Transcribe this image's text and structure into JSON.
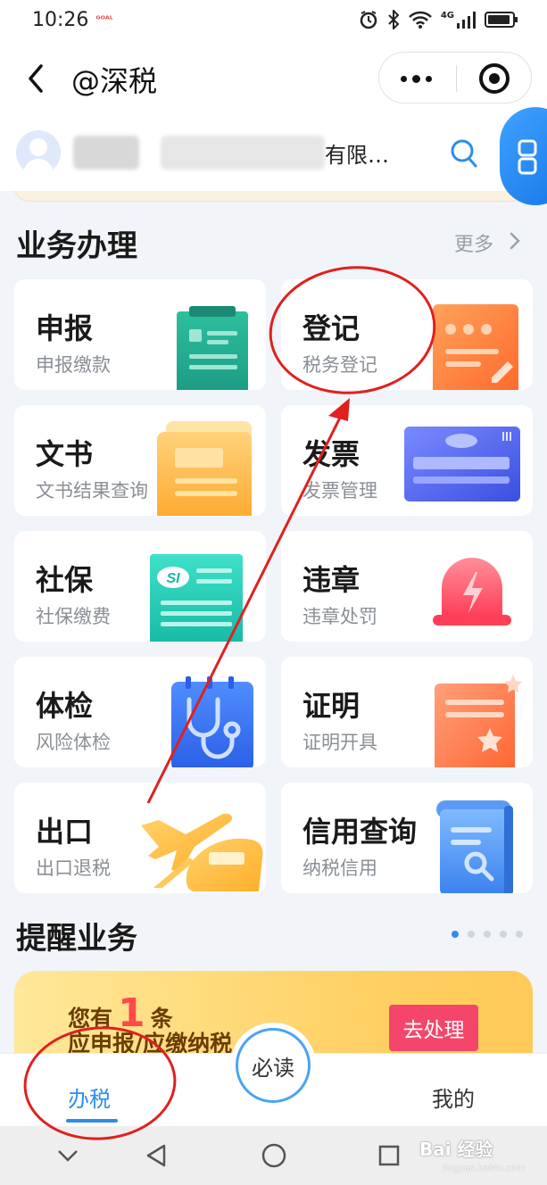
{
  "status_bar": {
    "time": "10:26",
    "badge_text": "ᴳᴼᴬᴸ",
    "network": "4G",
    "colors": {
      "text": "#222222"
    }
  },
  "nav": {
    "title": "@深税",
    "back_icon": "chevron-left-icon",
    "more_icon": "more-dots-icon",
    "close_icon": "target-icon"
  },
  "account": {
    "company_name": "有限…",
    "search_icon": "search-icon",
    "float_icon": "grid-icon"
  },
  "business": {
    "title": "业务办理",
    "more_label": "更多",
    "items": [
      {
        "title": "申报",
        "subtitle": "申报缴款"
      },
      {
        "title": "登记",
        "subtitle": "税务登记"
      },
      {
        "title": "文书",
        "subtitle": "文书结果查询"
      },
      {
        "title": "发票",
        "subtitle": "发票管理"
      },
      {
        "title": "社保",
        "subtitle": "社保缴费"
      },
      {
        "title": "违章",
        "subtitle": "违章处罚"
      },
      {
        "title": "体检",
        "subtitle": "风险体检"
      },
      {
        "title": "证明",
        "subtitle": "证明开具"
      },
      {
        "title": "出口",
        "subtitle": "出口退税"
      },
      {
        "title": "信用查询",
        "subtitle": "纳税信用"
      }
    ],
    "shebao_badge": "SI"
  },
  "reminder": {
    "title": "提醒业务",
    "prefix": "您有",
    "count": "1",
    "suffix": "条",
    "line2": "应申报/应缴纳税",
    "button": "去处理",
    "page_count": 5,
    "active_page": 1,
    "colors": {
      "button": "#f4466a",
      "count": "#ff4a4a"
    }
  },
  "tabbar": {
    "tab1": "办税",
    "center": "必读",
    "tab3": "我的",
    "colors": {
      "active": "#2d8cf0"
    }
  },
  "watermark": {
    "text": "Bai 经验",
    "sub": "jingyan.baidu.com"
  },
  "annotations": {
    "color": "#e02020"
  }
}
